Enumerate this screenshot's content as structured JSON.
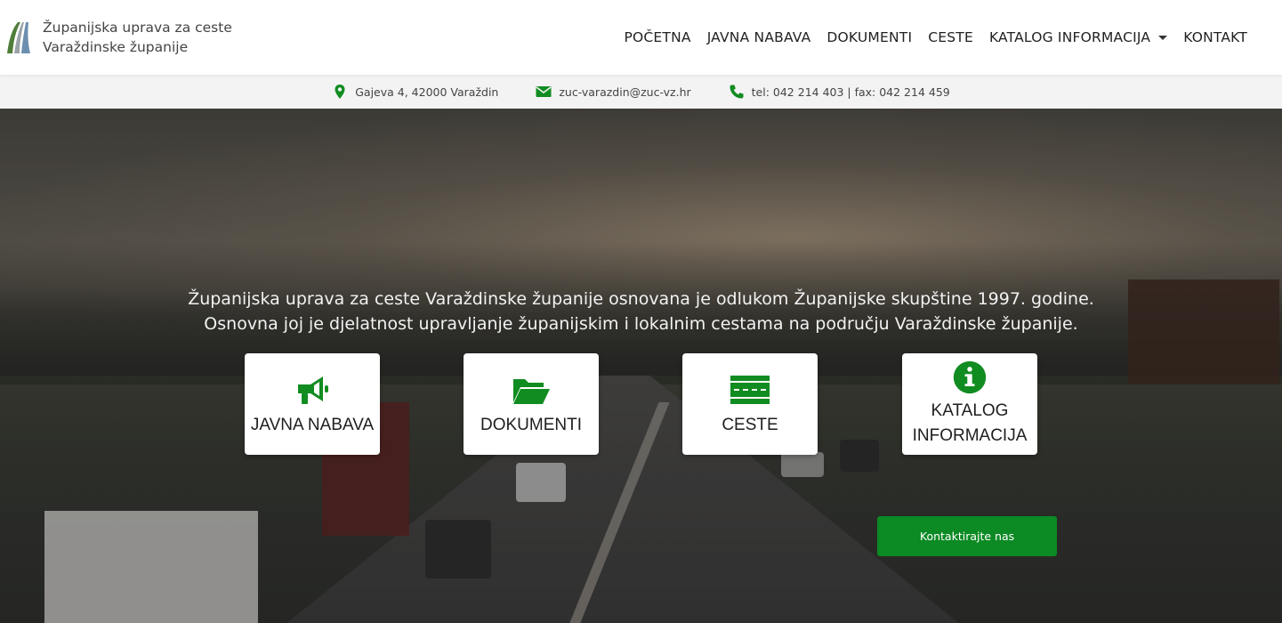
{
  "brand": {
    "line1": "Županijska uprava za ceste",
    "line2": "Varaždinske županije"
  },
  "nav": {
    "items": [
      "POČETNA",
      "JAVNA NABAVA",
      "DOKUMENTI",
      "CESTE",
      "KATALOG INFORMACIJA",
      "KONTAKT"
    ]
  },
  "info": {
    "address": "Gajeva 4, 42000 Varaždin",
    "email": "zuc-varazdin@zuc-vz.hr",
    "phone": "tel: 042 214 403 | fax: 042 214 459"
  },
  "hero": {
    "line1": "Županijska uprava za ceste Varaždinske županije osnovana je odlukom Županijske skupštine 1997. godine.",
    "line2": "Osnovna joj je djelatnost upravljanje županijskim i lokalnim cestama na području Varaždinske županije."
  },
  "cards": [
    {
      "label": "JAVNA NABAVA",
      "icon": "megaphone-icon"
    },
    {
      "label": "DOKUMENTI",
      "icon": "folder-open-icon"
    },
    {
      "label": "CESTE",
      "icon": "road-icon"
    },
    {
      "label": "KATALOG INFORMACIJA",
      "icon": "info-circle-icon"
    }
  ],
  "cta": {
    "label": "Kontaktirajte nas"
  },
  "colors": {
    "accent": "#0c8a23",
    "icon_green": "#118c21"
  }
}
